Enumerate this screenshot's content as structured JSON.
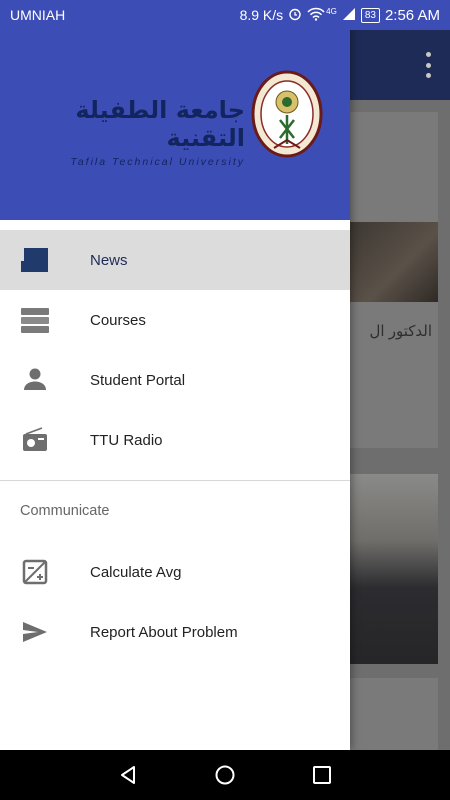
{
  "status_bar": {
    "carrier": "UMNIAH",
    "speed": "8.9 K/s",
    "network_badge": "4G",
    "battery": "83",
    "time": "2:56 AM"
  },
  "drawer": {
    "logo": {
      "arabic": "جامعة الطفيلة التقنية",
      "english": "Tafila Technical University"
    },
    "items": [
      {
        "label": "News",
        "icon": "news-icon",
        "active": true
      },
      {
        "label": "Courses",
        "icon": "books-icon",
        "active": false
      },
      {
        "label": "Student Portal",
        "icon": "person-icon",
        "active": false
      },
      {
        "label": "TTU Radio",
        "icon": "radio-icon",
        "active": false
      }
    ],
    "section_title": "Communicate",
    "communicate_items": [
      {
        "label": "Calculate Avg",
        "icon": "calculator-icon"
      },
      {
        "label": "Report About Problem",
        "icon": "send-icon"
      }
    ]
  },
  "background_app": {
    "card_text": "الدكتور ال"
  },
  "colors": {
    "header": "#3d4db6",
    "active_item": "#dcdcdc",
    "accent_dark": "#1f2b57"
  }
}
